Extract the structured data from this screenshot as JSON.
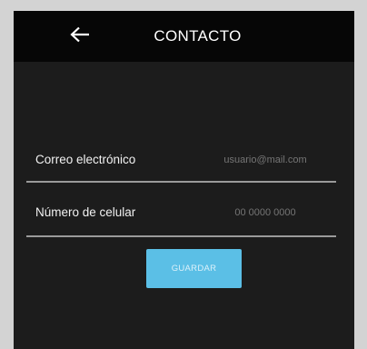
{
  "header": {
    "title": "CONTACTO",
    "back_icon": "arrow-left-icon"
  },
  "form": {
    "email": {
      "label": "Correo electrónico",
      "placeholder": "usuario@mail.com"
    },
    "phone": {
      "label": "Número de celular",
      "placeholder": "00 0000 0000"
    }
  },
  "actions": {
    "save_label": "GUARDAR"
  },
  "colors": {
    "header_bg": "#060606",
    "screen_bg": "#1c1c1c",
    "button_bg": "#5bbfe6",
    "outer_bg": "#d3d3d3"
  }
}
